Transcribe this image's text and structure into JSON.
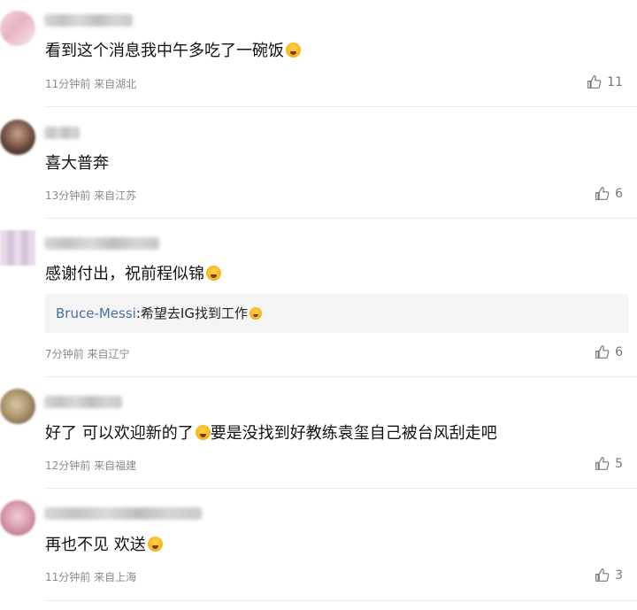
{
  "comments": [
    {
      "text": "看到这个消息我中午多吃了一碗饭",
      "emoji": "shocked-face-emoji",
      "time": "11分钟前",
      "location": "来自湖北",
      "likes": "11"
    },
    {
      "text": "喜大普奔",
      "time": "13分钟前",
      "location": "来自江苏",
      "likes": "6"
    },
    {
      "text": "感谢付出，祝前程似锦",
      "emoji": "shocked-face-emoji",
      "reply_user": "Bruce-Messi",
      "reply_sep": ":",
      "reply_text": "希望去IG找到工作",
      "reply_emoji": "laughing-face-emoji",
      "time": "7分钟前",
      "location": "来自辽宁",
      "likes": "6"
    },
    {
      "text_part1": "好了 可以欢迎新的了",
      "emoji": "laughing-face-emoji",
      "text_part2": "要是没找到好教练袁玺自己被台风刮走吧",
      "time": "12分钟前",
      "location": "来自福建",
      "likes": "5"
    },
    {
      "text": "再也不见 欢送",
      "emoji": "grinning-face-emoji",
      "time": "11分钟前",
      "location": "来自上海",
      "likes": "3"
    }
  ],
  "colors": {
    "link_blue": "#4a6fa5",
    "meta_gray": "#8a8a8a",
    "reply_bg": "#f4f4f4"
  }
}
